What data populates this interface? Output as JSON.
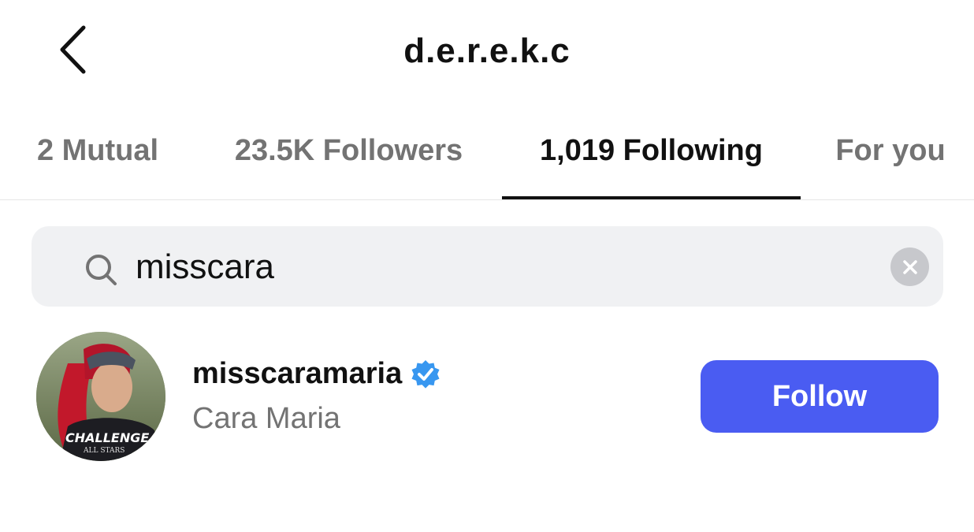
{
  "header": {
    "title": "d.e.r.e.k.c",
    "back_icon": "chevron-left-icon"
  },
  "tabs": [
    {
      "label": "2 Mutual",
      "active": false
    },
    {
      "label": "23.5K Followers",
      "active": false
    },
    {
      "label": "1,019 Following",
      "active": true
    },
    {
      "label": "For you",
      "active": false
    }
  ],
  "search": {
    "value": "misscara",
    "icon": "search-icon",
    "clear_icon": "clear-icon"
  },
  "results": [
    {
      "username": "misscaramaria",
      "verified": true,
      "full_name": "Cara Maria",
      "action_label": "Follow",
      "avatar_shirt_text": "CHALLENGE",
      "avatar_shirt_subtext": "ALL STARS"
    }
  ],
  "colors": {
    "accent": "#4a5cf2",
    "verified": "#3897f0",
    "muted_text": "#737373",
    "search_bg": "#f0f1f3"
  }
}
